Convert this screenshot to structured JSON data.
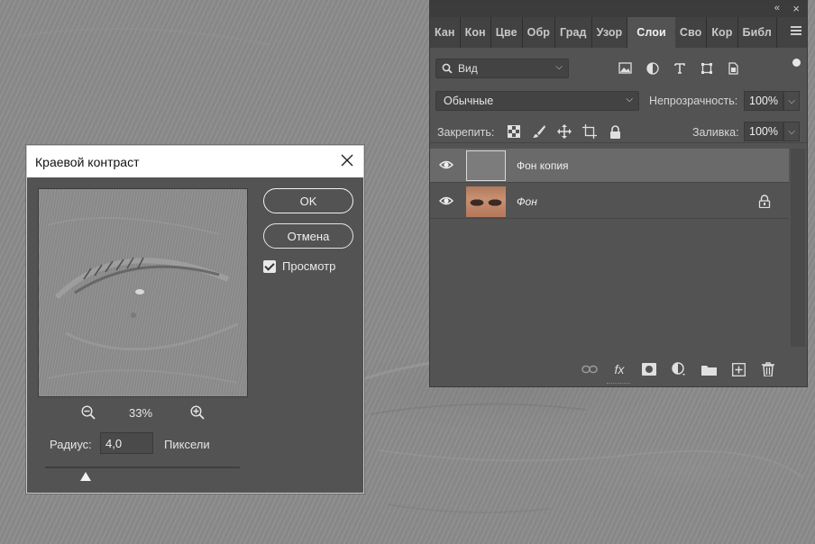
{
  "panel": {
    "tabs": [
      {
        "label": "Кан"
      },
      {
        "label": "Кон"
      },
      {
        "label": "Цве"
      },
      {
        "label": "Обр"
      },
      {
        "label": "Град"
      },
      {
        "label": "Узор"
      },
      {
        "label": "Слои"
      },
      {
        "label": "Сво"
      },
      {
        "label": "Кор"
      },
      {
        "label": "Библ"
      }
    ],
    "active_tab": "Слои",
    "collapse_glyph": "«",
    "close_glyph": "×",
    "filter": {
      "label": "Вид"
    },
    "blend_mode": "Обычные",
    "opacity_label": "Непрозрачность:",
    "opacity_value": "100%",
    "lock_label": "Закрепить:",
    "fill_label": "Заливка:",
    "fill_value": "100%",
    "layers": [
      {
        "name": "Фон копия",
        "visible": true,
        "selected": true,
        "locked": false
      },
      {
        "name": "Фон",
        "visible": true,
        "selected": false,
        "locked": true
      }
    ],
    "bottom_fx_label": "fx"
  },
  "dialog": {
    "title": "Краевой контраст",
    "ok_label": "OK",
    "cancel_label": "Отмена",
    "preview_label": "Просмотр",
    "preview_checked": true,
    "zoom": "33%",
    "radius_label": "Радиус:",
    "radius_value": "4,0",
    "units_label": "Пиксели"
  },
  "colors": {
    "panel_bg": "#535353",
    "tab_bar_bg": "#424242",
    "selected_layer": "#6a6a6a",
    "canvas": "#8b8b8b",
    "title_bar": "#ffffff"
  }
}
